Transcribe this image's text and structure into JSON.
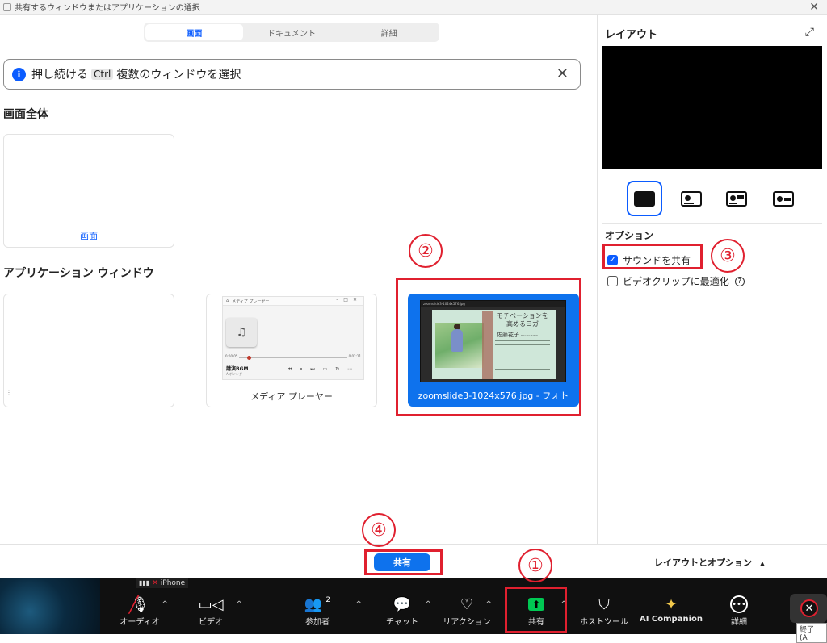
{
  "window": {
    "title": "共有するウィンドウまたはアプリケーションの選択"
  },
  "tabs": [
    {
      "label": "画面"
    },
    {
      "label": "ドキュメント"
    },
    {
      "label": "詳細"
    }
  ],
  "banner": {
    "text_before": "押し続ける",
    "key": "Ctrl",
    "text_after": "複数のウィンドウを選択"
  },
  "screen_section": {
    "heading": "画面全体",
    "card_label": "画面"
  },
  "apps_section": {
    "heading": "アプリケーション ウィンドウ",
    "media_player": {
      "label": "メディア プレーヤー",
      "window_title": "メディア プレーヤー",
      "time_start": "0:00:05",
      "time_end": "0:02:11",
      "track_title": "講演BGM",
      "track_sub": "AIボソング"
    },
    "photo_window": {
      "label": "zoomslide3-1024x576.jpg - フォト",
      "window_title": "zoomslide3-1024x576.jpg",
      "slide_title_1": "モチベーションを",
      "slide_title_2": "高めるヨガ",
      "slide_name": "佐藤花子",
      "slide_name_en": "Hanako Satoh"
    }
  },
  "annotations": {
    "c1": "①",
    "c2": "②",
    "c3": "③",
    "c4": "④"
  },
  "right_panel": {
    "layout_title": "レイアウト",
    "options_title": "オプション",
    "share_sound": "サウンドを共有",
    "share_sound_caret": "⌄",
    "optimize_video": "ビデオクリップに最適化",
    "help": "?"
  },
  "bottom": {
    "share_button": "共有",
    "layout_options": "レイアウトとオプション",
    "layout_options_caret": "▲"
  },
  "toolbar": {
    "iphone": "iPhone",
    "audio": "オーディオ",
    "video": "ビデオ",
    "participants": "参加者",
    "participants_count": "2",
    "chat": "チャット",
    "reaction": "リアクション",
    "share": "共有",
    "host_tools": "ホストツール",
    "ai_companion": "AI Companion",
    "more": "詳細",
    "end": "終了 (A",
    "caret": "^"
  },
  "colors": {
    "accent": "#0b5cff",
    "share_green": "#00c853",
    "annotation_red": "#e0202f",
    "toolbar_bg": "#101010"
  }
}
